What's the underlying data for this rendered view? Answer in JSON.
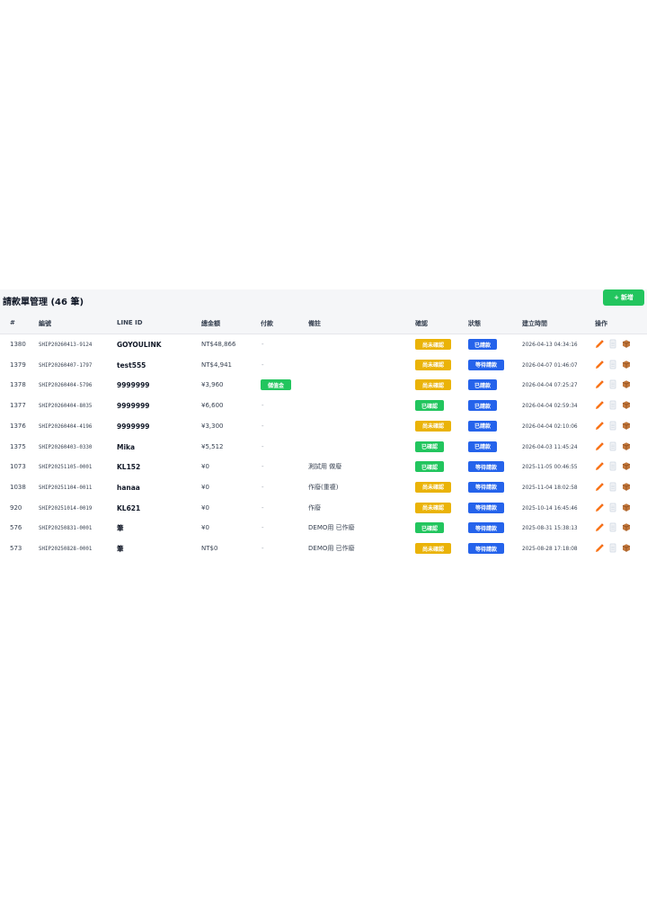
{
  "title": "請款單管理 (46 筆)",
  "add_button": {
    "icon": "+",
    "label": "新增"
  },
  "columns": [
    "#",
    "編號",
    "LINE ID",
    "總金額",
    "付款",
    "備註",
    "確認",
    "狀態",
    "建立時間",
    "操作"
  ],
  "colors": {
    "confirmed": "#22c55e",
    "unconfirmed": "#eab308",
    "status": "#2563eb",
    "wallet": "#22c55e",
    "add": "#22c55e"
  },
  "rows": [
    {
      "id": "1380",
      "code": "SHIP20260413-9124",
      "line_id": "GOYOULINK",
      "amount": "NT$48,866",
      "payment": "-",
      "note": "",
      "confirm": "尚未確認",
      "confirm_type": "unconfirmed",
      "status": "已請款",
      "created": "2026-04-13 04:34:16"
    },
    {
      "id": "1379",
      "code": "SHIP20260407-1797",
      "line_id": "test555",
      "amount": "NT$4,941",
      "payment": "-",
      "note": "",
      "confirm": "尚未確認",
      "confirm_type": "unconfirmed",
      "status": "等待請款",
      "created": "2026-04-07 01:46:07"
    },
    {
      "id": "1378",
      "code": "SHIP20260404-5796",
      "line_id": "9999999",
      "amount": "¥3,960",
      "payment": "儲值金",
      "note": "",
      "confirm": "尚未確認",
      "confirm_type": "unconfirmed",
      "status": "已請款",
      "created": "2026-04-04 07:25:27"
    },
    {
      "id": "1377",
      "code": "SHIP20260404-8035",
      "line_id": "9999999",
      "amount": "¥6,600",
      "payment": "-",
      "note": "",
      "confirm": "已確認",
      "confirm_type": "confirmed",
      "status": "已請款",
      "created": "2026-04-04 02:59:34"
    },
    {
      "id": "1376",
      "code": "SHIP20260404-4196",
      "line_id": "9999999",
      "amount": "¥3,300",
      "payment": "-",
      "note": "",
      "confirm": "尚未確認",
      "confirm_type": "unconfirmed",
      "status": "已請款",
      "created": "2026-04-04 02:10:06"
    },
    {
      "id": "1375",
      "code": "SHIP20260403-0330",
      "line_id": "Mika",
      "amount": "¥5,512",
      "payment": "-",
      "note": "",
      "confirm": "已確認",
      "confirm_type": "confirmed",
      "status": "已請款",
      "created": "2026-04-03 11:45:24"
    },
    {
      "id": "1073",
      "code": "SHIP20251105-0001",
      "line_id": "KL152",
      "amount": "¥0",
      "payment": "-",
      "note": "測試用 做廢",
      "confirm": "已確認",
      "confirm_type": "confirmed",
      "status": "等待請款",
      "created": "2025-11-05 00:46:55"
    },
    {
      "id": "1038",
      "code": "SHIP20251104-0011",
      "line_id": "hanaa",
      "amount": "¥0",
      "payment": "-",
      "note": "作廢(重複)",
      "confirm": "尚未確認",
      "confirm_type": "unconfirmed",
      "status": "等待請款",
      "created": "2025-11-04 18:02:58"
    },
    {
      "id": "920",
      "code": "SHIP20251014-0019",
      "line_id": "KL621",
      "amount": "¥0",
      "payment": "-",
      "note": "作廢",
      "confirm": "尚未確認",
      "confirm_type": "unconfirmed",
      "status": "等待請款",
      "created": "2025-10-14 16:45:46"
    },
    {
      "id": "576",
      "code": "SHIP20250831-0001",
      "line_id": "筆",
      "amount": "¥0",
      "payment": "-",
      "note": "DEMO用 已作廢",
      "confirm": "已確認",
      "confirm_type": "confirmed",
      "status": "等待請款",
      "created": "2025-08-31 15:38:13"
    },
    {
      "id": "573",
      "code": "SHIP20250828-0001",
      "line_id": "筆",
      "amount": "NT$0",
      "payment": "-",
      "note": "DEMO用 已作廢",
      "confirm": "尚未確認",
      "confirm_type": "unconfirmed",
      "status": "等待請款",
      "created": "2025-08-28 17:18:08"
    }
  ],
  "row_actions": [
    "edit-pencil-icon",
    "document-icon",
    "package-box-icon"
  ]
}
